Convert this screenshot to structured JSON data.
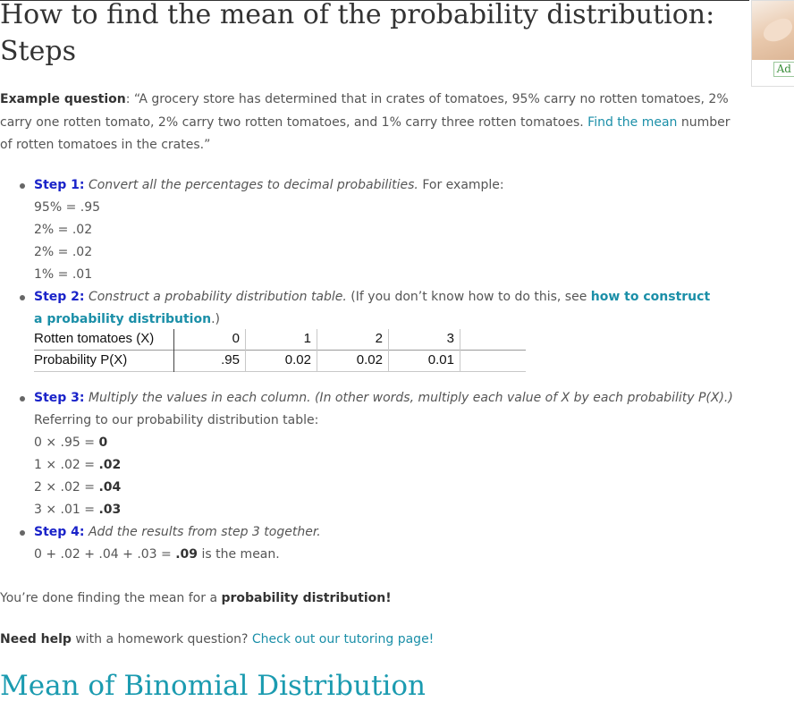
{
  "title": {
    "line1": "How to find the mean of the probability distribution:",
    "line2": "Steps"
  },
  "ad": {
    "badge": "Ad"
  },
  "example": {
    "label": "Example question",
    "colon": ":",
    "text_before": " “A grocery store has determined that in crates of tomatoes,  95% carry no rotten tomatoes, 2% carry one rotten tomato, 2% carry two rotten tomatoes, and 1% carry three rotten tomatoes.  ",
    "link": "Find the mean",
    "text_after": " number of rotten tomatoes in the crates.”"
  },
  "step1": {
    "label": "Step 1:",
    "italic": "Convert all the percentages to decimal probabilities.",
    "text": " For example:",
    "lines": [
      "95% = .95",
      "2% = .02",
      "2% = .02",
      "1% = .01"
    ]
  },
  "step2": {
    "label": "Step 2:",
    "italic": "Construct a probability distribution table.",
    "text": " (If you don’t know how to do this, see ",
    "link": "how to construct a probability distribution",
    "text_after": ".)"
  },
  "table": {
    "row1_label": "Rotten tomatoes (X)",
    "row1_values": [
      "0",
      "1",
      "2",
      "3"
    ],
    "row2_label": "Probability P(X)",
    "row2_values": [
      ".95",
      "0.02",
      "0.02",
      "0.01"
    ]
  },
  "step3": {
    "label": "Step 3:",
    "italic": "Multiply the values in each column. (In other words, multiply each value of X by each probability P(X).)",
    "intro": "Referring to our probability distribution table:",
    "lines": [
      {
        "expr": "0 × .95 = ",
        "result": "0"
      },
      {
        "expr": "1 × .02  = ",
        "result": ".02"
      },
      {
        "expr": "2 × .02  = ",
        "result": ".04"
      },
      {
        "expr": "3 × .01 = ",
        "result": ".03"
      }
    ]
  },
  "step4": {
    "label": "Step 4:",
    "italic": "Add the results from step 3 together.",
    "expr": "0 + .02 + .04 + .03 = ",
    "result": ".09",
    "after": " is the mean."
  },
  "done": {
    "text": "You’re done finding the mean for a ",
    "bold": "probability distribution!"
  },
  "help": {
    "bold": "Need help",
    "text": " with a homework question? ",
    "link": "Check out our tutoring page!"
  },
  "section": {
    "title": "Mean of Binomial Distribution"
  }
}
